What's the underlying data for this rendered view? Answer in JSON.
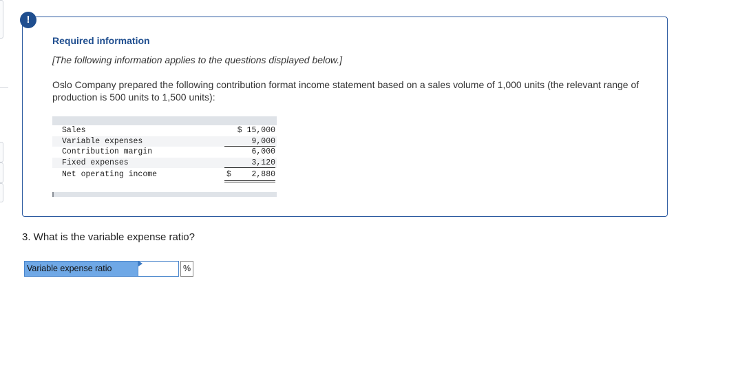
{
  "info_box": {
    "alert_symbol": "!",
    "title": "Required information",
    "note": "[The following information applies to the questions displayed below.]",
    "paragraph": "Oslo Company prepared the following contribution format income statement based on a sales volume of 1,000 units (the relevant range of production is 500 units to 1,500 units):"
  },
  "statement": {
    "rows": [
      {
        "label": "Sales",
        "value": "$ 15,000"
      },
      {
        "label": "Variable expenses",
        "value": "9,000"
      },
      {
        "label": "Contribution margin",
        "value": "6,000"
      },
      {
        "label": "Fixed expenses",
        "value": "3,120"
      },
      {
        "label": "Net operating income",
        "dollar": "$",
        "value": "2,880"
      }
    ]
  },
  "question": {
    "text": "3. What is the variable expense ratio?",
    "answer_label": "Variable expense ratio",
    "answer_value": "",
    "answer_unit": "%"
  },
  "icons": {
    "alert": "exclamation-circle-icon"
  },
  "colors": {
    "accent": "#1f4e8f",
    "box_border": "#2c5aa0",
    "label_bg": "#6fa8e6"
  }
}
